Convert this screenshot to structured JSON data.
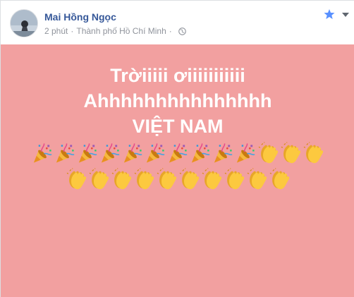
{
  "post": {
    "author": "Mai Hồng Ngọc",
    "time": "2 phút",
    "separator": "·",
    "location": "Thành phố Hồ Chí Minh",
    "privacy_icon": "globe-icon",
    "star_icon": "star-icon",
    "menu_icon": "chevron-down-icon"
  },
  "status": {
    "background_color": "#f2a0a0",
    "lines": [
      "Trờiiiii ơiiiiiiiiiii",
      "Ahhhhhhhhhhhhhhh",
      "VIỆT NAM"
    ],
    "emoji_row1": [
      "party-popper",
      "party-popper",
      "party-popper",
      "party-popper",
      "party-popper",
      "party-popper",
      "party-popper",
      "party-popper",
      "party-popper",
      "party-popper",
      "clapping-hands",
      "clapping-hands",
      "clapping-hands"
    ],
    "emoji_row2": [
      "clapping-hands",
      "clapping-hands",
      "clapping-hands",
      "clapping-hands",
      "clapping-hands",
      "clapping-hands",
      "clapping-hands",
      "clapping-hands",
      "clapping-hands",
      "clapping-hands"
    ]
  }
}
